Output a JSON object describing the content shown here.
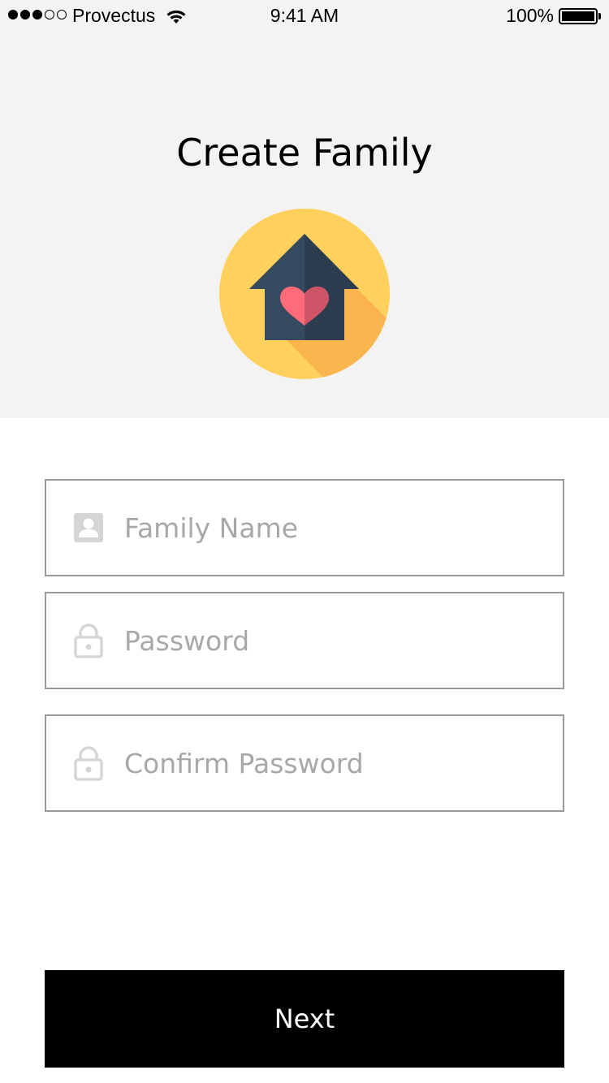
{
  "status_bar": {
    "signal_bars_filled": 3,
    "signal_bars_total": 5,
    "carrier": "Provectus",
    "time": "9:41 AM",
    "battery_percent": "100%"
  },
  "header": {
    "title": "Create Family",
    "logo_icon": "house-heart-icon"
  },
  "form": {
    "family_name": {
      "placeholder": "Family Name",
      "value": "",
      "icon": "contact-card-icon"
    },
    "password": {
      "placeholder": "Password",
      "value": "",
      "icon": "lock-icon"
    },
    "confirm_password": {
      "placeholder": "Confirm Password",
      "value": "",
      "icon": "lock-icon"
    }
  },
  "actions": {
    "next_label": "Next"
  },
  "colors": {
    "header_background": "#f3f3f3",
    "logo_circle": "#ffd05b",
    "logo_shadow": "#fbb54f",
    "house": "#344a5e",
    "heart": "#ff6b7a",
    "button_background": "#000000",
    "field_border": "#9a9a9a",
    "placeholder": "#a8a8a8"
  }
}
